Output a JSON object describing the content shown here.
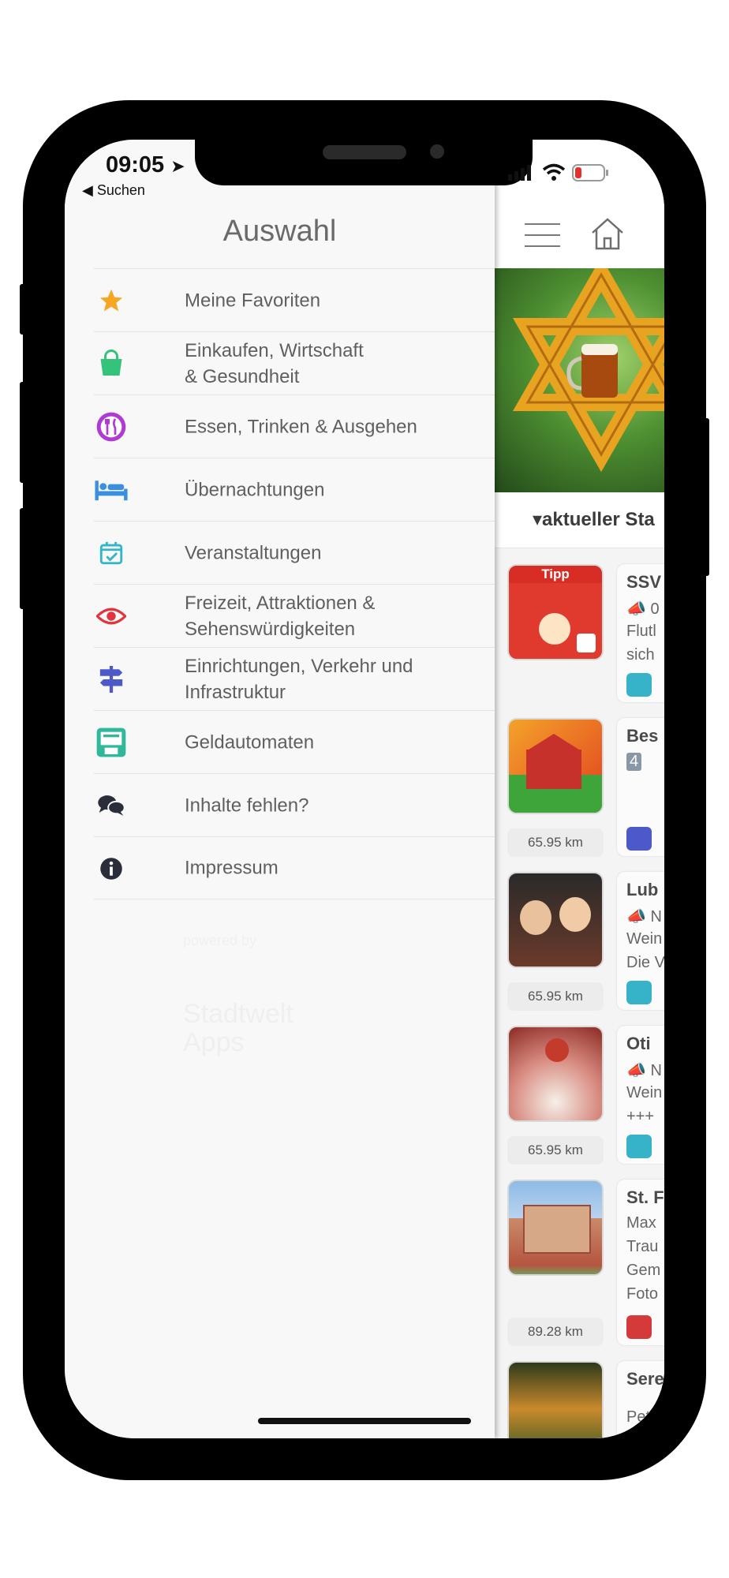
{
  "status": {
    "time": "09:05",
    "back_label": "◀ Suchen"
  },
  "drawer": {
    "title": "Auswahl",
    "items": [
      {
        "label": "Meine Favoriten",
        "icon": "star-icon",
        "color": "#f6a623"
      },
      {
        "label": "Einkaufen, Wirtschaft\n& Gesundheit",
        "icon": "shopping-bag-icon",
        "color": "#34c37a"
      },
      {
        "label": "Essen, Trinken & Ausgehen",
        "icon": "cutlery-icon",
        "color": "#b23ad4"
      },
      {
        "label": "Übernachtungen",
        "icon": "bed-icon",
        "color": "#3b8fe0"
      },
      {
        "label": "Veranstaltungen",
        "icon": "calendar-icon",
        "color": "#2fb6c9"
      },
      {
        "label": "Freizeit, Attraktionen &\nSehenswürdigkeiten",
        "icon": "eye-icon",
        "color": "#e0353f"
      },
      {
        "label": "Einrichtungen, Verkehr und\nInfrastruktur",
        "icon": "signpost-icon",
        "color": "#4d59c9"
      },
      {
        "label": "Geldautomaten",
        "icon": "atm-icon",
        "color": "#2fb89a"
      },
      {
        "label": "Inhalte fehlen?",
        "icon": "chat-icon",
        "color": "#2a2e3a"
      },
      {
        "label": "Impressum",
        "icon": "info-icon",
        "color": "#2a2e3a"
      }
    ],
    "watermark_small": "powered by",
    "watermark_large": "Stadtwelt\nApps"
  },
  "app": {
    "status_label": "aktueller Sta",
    "feed": [
      {
        "title": "SSV",
        "line1": "📣 0",
        "line2": "Flutl",
        "line3": "sich",
        "distance": "",
        "thumb_text": "Tipp",
        "cat_color": "#36b3c9"
      },
      {
        "title": "Bes",
        "line1": "4",
        "line2": "",
        "line3": "",
        "distance": "65.95 km",
        "thumb_text": "",
        "cat_color": "#4d59c9"
      },
      {
        "title": "Lub",
        "line1": "📣 N",
        "line2": "Wein",
        "line3": "Die V",
        "distance": "65.95 km",
        "thumb_text": "",
        "cat_color": "#36b3c9"
      },
      {
        "title": "Oti",
        "line1": "📣 N",
        "line2": "Wein",
        "line3": "+++",
        "distance": "65.95 km",
        "thumb_text": "",
        "cat_color": "#36b3c9"
      },
      {
        "title": "St. F",
        "line1": "Max",
        "line2": "Trau",
        "line3": "Gem",
        "line4": "Foto",
        "distance": "89.28 km",
        "thumb_text": "",
        "cat_color": "#d43a3a"
      },
      {
        "title": "Sere",
        "line1": "Pet",
        "line2": "",
        "line3": "",
        "distance": "",
        "thumb_text": "",
        "cat_color": ""
      }
    ]
  }
}
